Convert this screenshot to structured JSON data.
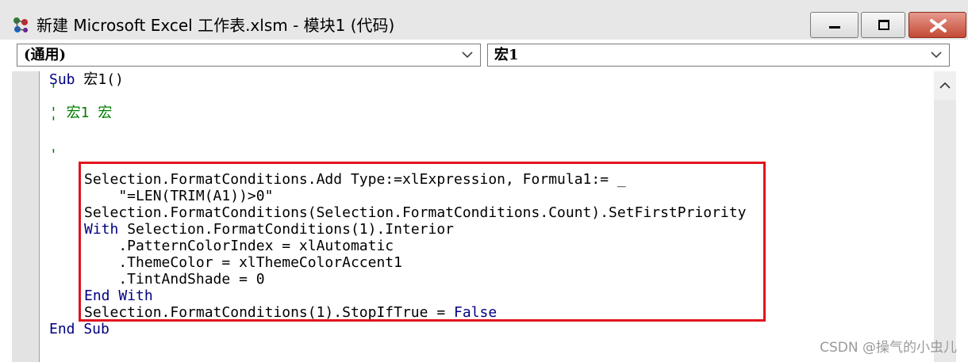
{
  "window": {
    "title": "新建 Microsoft Excel 工作表.xlsm - 模块1 (代码)"
  },
  "toolbar": {
    "object_dropdown": "(通用)",
    "procedure_dropdown": "宏1"
  },
  "code": {
    "line1_kw": "Sub",
    "line1_rest": " 宏1()",
    "comment_tick1": "'",
    "comment_macro": "' 宏1 宏",
    "comment_tick2": "'",
    "comment_tick3": "'",
    "line_fc1": "Selection.FormatConditions.Add Type:=xlExpression, Formula1:= _",
    "line_fc2": "    \"=LEN(TRIM(A1))>0\"",
    "line_fc3": "Selection.FormatConditions(Selection.FormatConditions.Count).SetFirstPriority",
    "with_kw": "With",
    "with_rest": " Selection.FormatConditions(1).Interior",
    "line_pattern": "    .PatternColorIndex = xlAutomatic",
    "line_theme": "    .ThemeColor = xlThemeColorAccent1",
    "line_tint": "    .TintAndShade = 0",
    "endwith_kw": "End With",
    "stop_rest": "Selection.FormatConditions(1).StopIfTrue = ",
    "stop_kw": "False",
    "endsub_kw": "End Sub"
  },
  "watermark": "CSDN @操气的小虫儿",
  "colors": {
    "keyword": "#00007f",
    "comment": "#007f00",
    "highlight_border": "#e0141e"
  }
}
